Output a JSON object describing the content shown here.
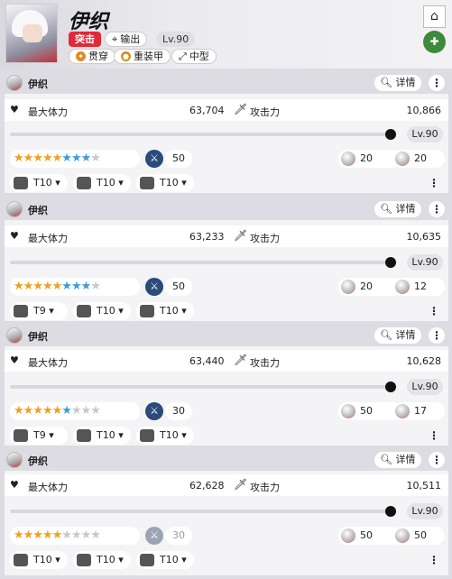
{
  "header": {
    "name": "伊织",
    "role_burst": "突击",
    "role_class": "输出",
    "level": "Lv.90",
    "weapon": "贯穿",
    "armor": "重装甲",
    "size": "中型"
  },
  "labels": {
    "details": "详情",
    "max_hp": "最大体力",
    "attack": "攻击力"
  },
  "cards": [
    {
      "name": "伊织",
      "hp": "63,704",
      "atk": "10,866",
      "level": "Lv.90",
      "gold": 5,
      "blue": 3,
      "grey": 1,
      "skill": "50",
      "cube1": "20",
      "cube2": "20",
      "gear": [
        "T10",
        "T10",
        "T10"
      ]
    },
    {
      "name": "伊织",
      "hp": "63,233",
      "atk": "10,635",
      "level": "Lv.90",
      "gold": 5,
      "blue": 3,
      "grey": 1,
      "skill": "50",
      "cube1": "20",
      "cube2": "12",
      "gear": [
        "T9",
        "T10",
        "T10"
      ]
    },
    {
      "name": "伊织",
      "hp": "63,440",
      "atk": "10,628",
      "level": "Lv.90",
      "gold": 5,
      "blue": 1,
      "grey": 3,
      "skill": "30",
      "cube1": "50",
      "cube2": "17",
      "gear": [
        "T9",
        "T10",
        "T10"
      ]
    },
    {
      "name": "伊织",
      "hp": "62,628",
      "atk": "10,511",
      "level": "Lv.90",
      "gold": 5,
      "blue": 0,
      "grey": 4,
      "skill": "30",
      "cube1": "50",
      "cube2": "50",
      "gear": [
        "T10",
        "T10",
        "T10"
      ]
    }
  ]
}
